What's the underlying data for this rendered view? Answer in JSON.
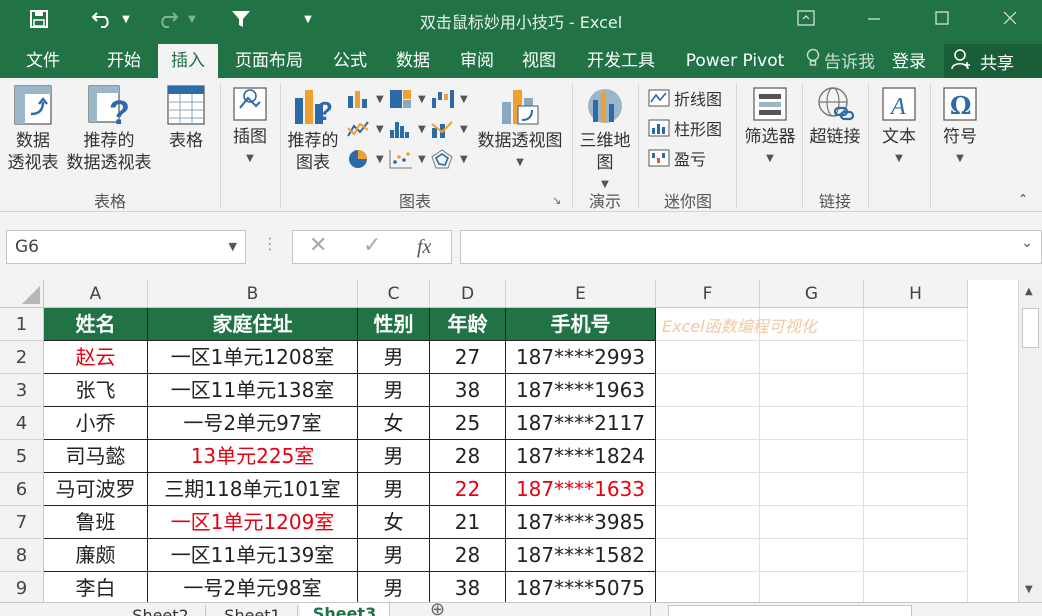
{
  "window": {
    "title": "双击鼠标妙用小技巧 - Excel"
  },
  "tabs": [
    "文件",
    "开始",
    "插入",
    "页面布局",
    "公式",
    "数据",
    "审阅",
    "视图",
    "开发工具",
    "Power Pivot"
  ],
  "active_tab": "插入",
  "tell_me": "告诉我",
  "login": "登录",
  "share": "共享",
  "ribbon": {
    "pivot_table": [
      "数据",
      "透视表"
    ],
    "recommended_pivot": [
      "推荐的",
      "数据透视表"
    ],
    "table": "表格",
    "group_tables": "表格",
    "illustrations": "插图",
    "recommended_charts": [
      "推荐的",
      "图表"
    ],
    "pivot_chart": "数据透视图",
    "group_charts": "图表",
    "map_3d": [
      "三维地",
      "图"
    ],
    "group_tours": "演示",
    "spark_line": "折线图",
    "spark_column": "柱形图",
    "spark_winloss": "盈亏",
    "group_sparklines": "迷你图",
    "slicer": "筛选器",
    "hyperlink": "超链接",
    "group_links": "链接",
    "text": "文本",
    "symbol": "符号"
  },
  "name_box": "G6",
  "fx_label": "fx",
  "columns": [
    "A",
    "B",
    "C",
    "D",
    "E",
    "F",
    "G",
    "H"
  ],
  "rows": [
    "1",
    "2",
    "3",
    "4",
    "5",
    "6",
    "7",
    "8",
    "9"
  ],
  "table": {
    "headers": [
      "姓名",
      "家庭住址",
      "性别",
      "年龄",
      "手机号"
    ],
    "data": [
      [
        "赵云",
        "一区1单元1208室",
        "男",
        "27",
        "187****2993"
      ],
      [
        "张飞",
        "一区11单元138室",
        "男",
        "38",
        "187****1963"
      ],
      [
        "小乔",
        "一号2单元97室",
        "女",
        "25",
        "187****2117"
      ],
      [
        "司马懿",
        "13单元225室",
        "男",
        "28",
        "187****1824"
      ],
      [
        "马可波罗",
        "三期118单元101室",
        "男",
        "22",
        "187****1633"
      ],
      [
        "鲁班",
        "一区1单元1209室",
        "女",
        "21",
        "187****3985"
      ],
      [
        "廉颇",
        "一区11单元139室",
        "男",
        "28",
        "187****1582"
      ],
      [
        "李白",
        "一号2单元98室",
        "男",
        "38",
        "187****5075"
      ]
    ]
  },
  "watermark": "Excel函数编程可视化",
  "sheets": [
    "Sheet2",
    "Sheet1",
    "Sheet3"
  ],
  "active_sheet": "Sheet3",
  "colors": {
    "brand": "#217346",
    "highlight_red": "#e60012"
  }
}
